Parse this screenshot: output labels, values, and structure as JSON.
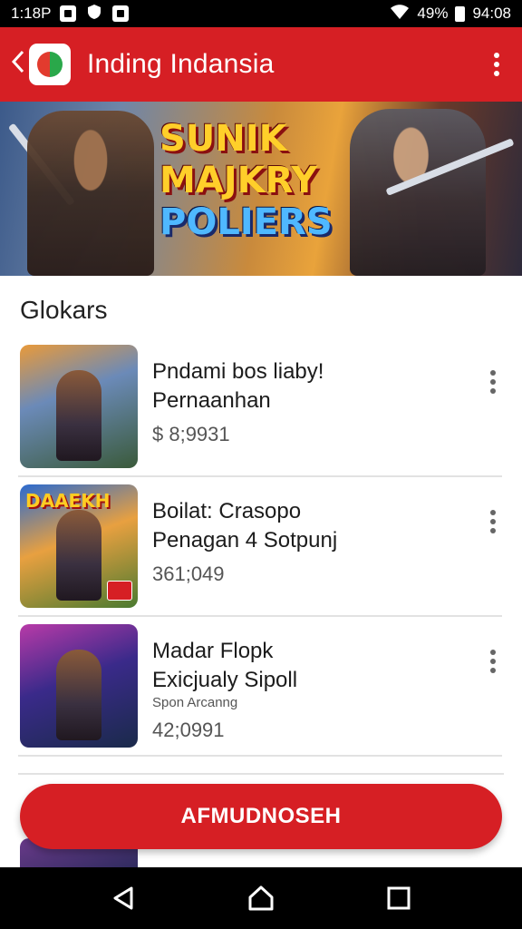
{
  "status_bar": {
    "time": "1:18P",
    "battery_text": "49%",
    "clock_right": "94:08"
  },
  "app_bar": {
    "title": "Inding Indansia",
    "back_icon": "chevron-left-icon",
    "menu_icon": "more-vert-icon"
  },
  "banner": {
    "title_line1": "SUNIK",
    "title_line2": "MAJKRY",
    "title_line3": "POLIERS"
  },
  "section": {
    "title": "Glokars"
  },
  "items": [
    {
      "line1": "Pndami bos liaby!",
      "line2": "Pernaanhan",
      "sub": "",
      "price": "$ 8;9931"
    },
    {
      "line1": "Boilat: Crasopo",
      "line2": "Penagan 4 Sotpunj",
      "sub": "",
      "price": "361;049",
      "thumb_label": "DAAEKH"
    },
    {
      "line1": "Madar Flopk",
      "line2": "Exicjualy Sipoll",
      "sub": "Spon Arcanng",
      "price": "42;0991"
    }
  ],
  "cta": {
    "label": "AFMUDNOSEH"
  },
  "nav_bar": {
    "back_icon": "nav-back-icon",
    "home_icon": "nav-home-icon",
    "recents_icon": "nav-recents-icon"
  },
  "colors": {
    "brand_red": "#d61f24"
  }
}
